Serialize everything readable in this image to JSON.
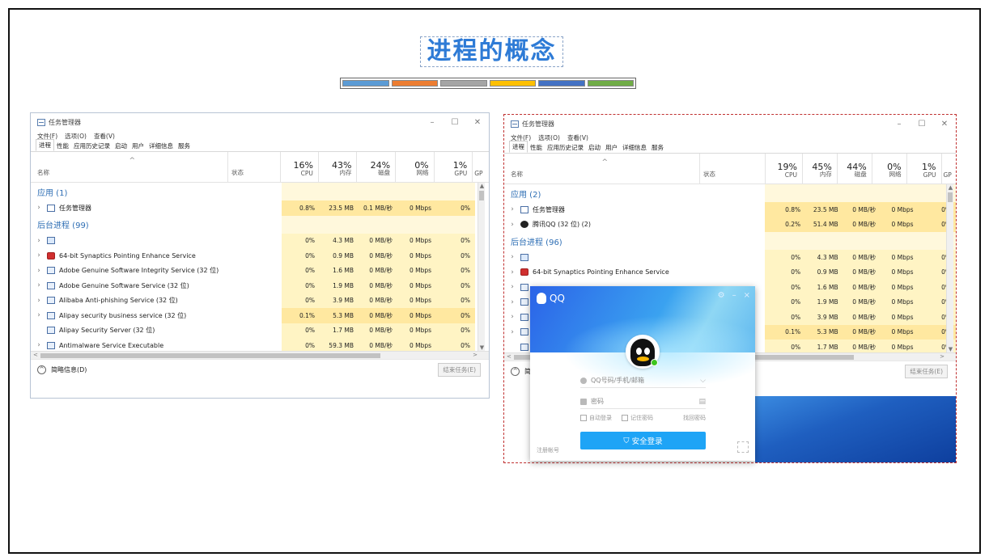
{
  "slide": {
    "title": "进程的概念",
    "accent_colors": [
      "#5b9bd5",
      "#ed7d31",
      "#a5a5a5",
      "#ffc000",
      "#4472c4",
      "#70ad47"
    ]
  },
  "left_tm": {
    "window_title": "任务管理器",
    "menu": [
      "文件(F)",
      "选项(O)",
      "查看(V)"
    ],
    "tabs": [
      "进程",
      "性能",
      "应用历史记录",
      "启动",
      "用户",
      "详细信息",
      "服务"
    ],
    "columns": {
      "name": "名称",
      "status": "状态",
      "cpu": {
        "pct": "16%",
        "label": "CPU"
      },
      "mem": {
        "pct": "43%",
        "label": "内存"
      },
      "disk": {
        "pct": "24%",
        "label": "磁盘"
      },
      "net": {
        "pct": "0%",
        "label": "网络"
      },
      "gpu": {
        "pct": "1%",
        "label": "GPU"
      },
      "gpu2": "GP"
    },
    "sections": [
      {
        "header": "应用 (1)",
        "rows": [
          {
            "name": "任务管理器",
            "icon": "task-manager-icon",
            "cpu": "0.8%",
            "mem": "23.5 MB",
            "disk": "0.1 MB/秒",
            "net": "0 Mbps",
            "gpu": "0%",
            "expand": true,
            "hot": true
          }
        ]
      },
      {
        "header": "后台进程 (99)",
        "rows": [
          {
            "name": "",
            "icon": "gear-icon",
            "cpu": "0%",
            "mem": "4.3 MB",
            "disk": "0 MB/秒",
            "net": "0 Mbps",
            "gpu": "0%",
            "expand": true
          },
          {
            "name": "64-bit Synaptics Pointing Enhance Service",
            "icon": "synaptics-icon",
            "cpu": "0%",
            "mem": "0.9 MB",
            "disk": "0 MB/秒",
            "net": "0 Mbps",
            "gpu": "0%",
            "expand": true
          },
          {
            "name": "Adobe Genuine Software Integrity Service (32 位)",
            "icon": "service-icon",
            "cpu": "0%",
            "mem": "1.6 MB",
            "disk": "0 MB/秒",
            "net": "0 Mbps",
            "gpu": "0%",
            "expand": true
          },
          {
            "name": "Adobe Genuine Software Service (32 位)",
            "icon": "service-icon",
            "cpu": "0%",
            "mem": "1.9 MB",
            "disk": "0 MB/秒",
            "net": "0 Mbps",
            "gpu": "0%",
            "expand": true
          },
          {
            "name": "Alibaba Anti-phishing Service (32 位)",
            "icon": "service-icon",
            "cpu": "0%",
            "mem": "3.9 MB",
            "disk": "0 MB/秒",
            "net": "0 Mbps",
            "gpu": "0%",
            "expand": true
          },
          {
            "name": "Alipay security business service (32 位)",
            "icon": "service-icon",
            "cpu": "0.1%",
            "mem": "5.3 MB",
            "disk": "0 MB/秒",
            "net": "0 Mbps",
            "gpu": "0%",
            "expand": true,
            "hot": true
          },
          {
            "name": "Alipay Security Server (32 位)",
            "icon": "service-icon",
            "cpu": "0%",
            "mem": "1.7 MB",
            "disk": "0 MB/秒",
            "net": "0 Mbps",
            "gpu": "0%",
            "expand": false
          },
          {
            "name": "Antimalware Service Executable",
            "icon": "service-icon",
            "cpu": "0%",
            "mem": "59.3 MB",
            "disk": "0 MB/秒",
            "net": "0 Mbps",
            "gpu": "0%",
            "expand": true
          }
        ]
      }
    ],
    "footer": {
      "fewer_details": "简略信息(D)",
      "end_task": "结束任务(E)"
    }
  },
  "right_tm": {
    "window_title": "任务管理器",
    "menu": [
      "文件(F)",
      "选项(O)",
      "查看(V)"
    ],
    "tabs": [
      "进程",
      "性能",
      "应用历史记录",
      "启动",
      "用户",
      "详细信息",
      "服务"
    ],
    "columns": {
      "name": "名称",
      "status": "状态",
      "cpu": {
        "pct": "19%",
        "label": "CPU"
      },
      "mem": {
        "pct": "45%",
        "label": "内存"
      },
      "disk": {
        "pct": "44%",
        "label": "磁盘"
      },
      "net": {
        "pct": "0%",
        "label": "网络"
      },
      "gpu": {
        "pct": "1%",
        "label": "GPU"
      },
      "gpu2": "GP"
    },
    "sections": [
      {
        "header": "应用 (2)",
        "rows": [
          {
            "name": "任务管理器",
            "icon": "task-manager-icon",
            "cpu": "0.8%",
            "mem": "23.5 MB",
            "disk": "0 MB/秒",
            "net": "0 Mbps",
            "gpu": "0%",
            "expand": true,
            "hot": true
          },
          {
            "name": "腾讯QQ (32 位) (2)",
            "icon": "qq-penguin-icon",
            "cpu": "0.2%",
            "mem": "51.4 MB",
            "disk": "0 MB/秒",
            "net": "0 Mbps",
            "gpu": "0%",
            "expand": true,
            "hot": true
          }
        ]
      },
      {
        "header": "后台进程 (96)",
        "rows": [
          {
            "name": "",
            "icon": "gear-icon",
            "cpu": "0%",
            "mem": "4.3 MB",
            "disk": "0 MB/秒",
            "net": "0 Mbps",
            "gpu": "0%",
            "expand": true
          },
          {
            "name": "64-bit Synaptics Pointing Enhance Service",
            "icon": "synaptics-icon",
            "cpu": "0%",
            "mem": "0.9 MB",
            "disk": "0 MB/秒",
            "net": "0 Mbps",
            "gpu": "0%",
            "expand": true
          },
          {
            "name": "",
            "icon": "service-icon",
            "cpu": "0%",
            "mem": "1.6 MB",
            "disk": "0 MB/秒",
            "net": "0 Mbps",
            "gpu": "0%",
            "expand": true
          },
          {
            "name": "",
            "icon": "service-icon",
            "cpu": "0%",
            "mem": "1.9 MB",
            "disk": "0 MB/秒",
            "net": "0 Mbps",
            "gpu": "0%",
            "expand": true
          },
          {
            "name": "",
            "icon": "service-icon",
            "cpu": "0%",
            "mem": "3.9 MB",
            "disk": "0 MB/秒",
            "net": "0 Mbps",
            "gpu": "0%",
            "expand": true
          },
          {
            "name": "",
            "icon": "service-icon",
            "cpu": "0.1%",
            "mem": "5.3 MB",
            "disk": "0 MB/秒",
            "net": "0 Mbps",
            "gpu": "0%",
            "expand": true,
            "hot": true
          },
          {
            "name": "",
            "icon": "service-icon",
            "cpu": "0%",
            "mem": "1.7 MB",
            "disk": "0 MB/秒",
            "net": "0 Mbps",
            "gpu": "0%",
            "expand": false
          }
        ]
      }
    ],
    "footer": {
      "fewer_details": "简",
      "end_task": "结束任务(E)"
    }
  },
  "qq_login": {
    "brand": "QQ",
    "account_placeholder": "QQ号码/手机/邮箱",
    "password_placeholder": "密码",
    "auto_login": "自动登录",
    "remember_password": "记住密码",
    "find_password": "找回密码",
    "login_button": "安全登录",
    "register": "注册帐号"
  }
}
